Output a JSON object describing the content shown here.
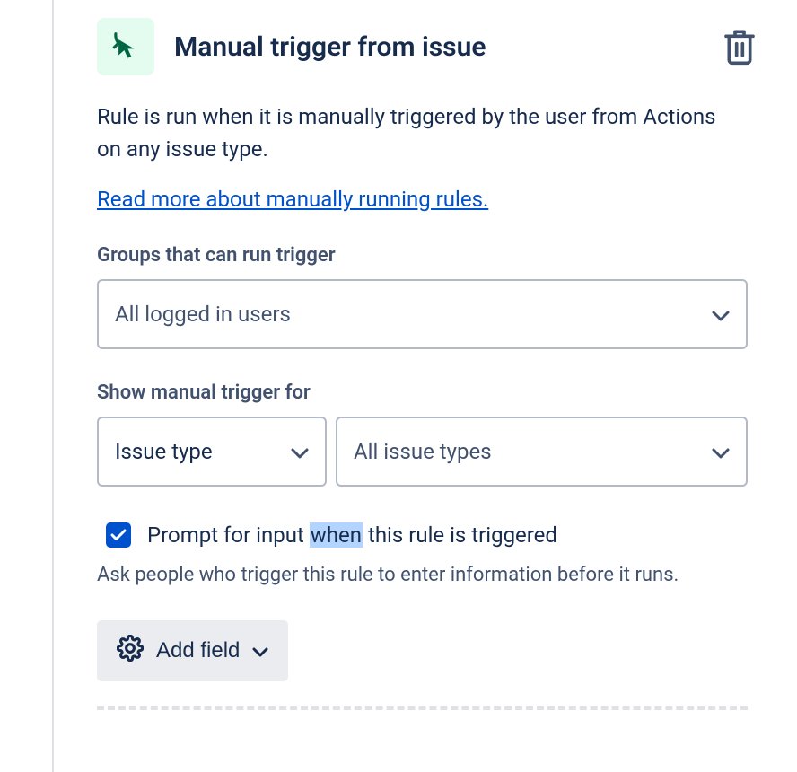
{
  "header": {
    "title": "Manual trigger from issue"
  },
  "description": "Rule is run when it is manually triggered by the user from Actions on any issue type.",
  "read_more_link": "Read more about manually running rules.",
  "groups_section": {
    "label": "Groups that can run trigger",
    "value": "All logged in users"
  },
  "show_section": {
    "label": "Show manual trigger for",
    "filter_type": "Issue type",
    "filter_value": "All issue types"
  },
  "prompt_checkbox": {
    "label_before": "Prompt for input ",
    "highlighted": "when",
    "label_after": " this rule is triggered",
    "help_text": "Ask people who trigger this rule to enter information before it runs."
  },
  "add_field_button": "Add field"
}
